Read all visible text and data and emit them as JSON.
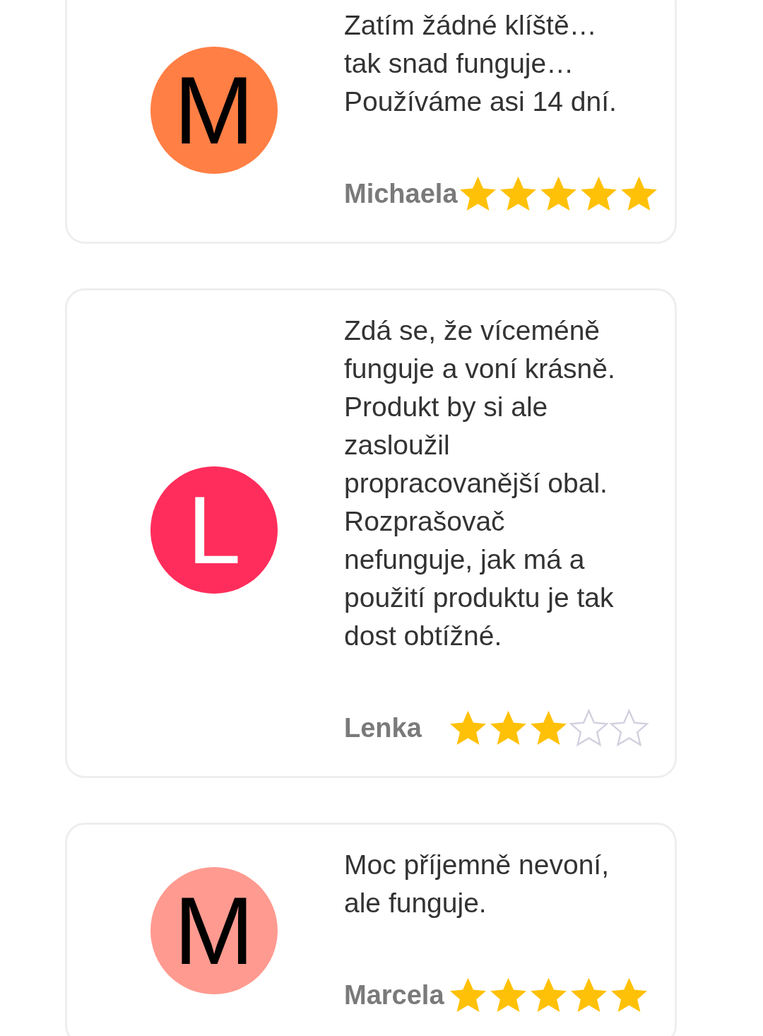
{
  "reviews": [
    {
      "initial": "M",
      "color": "#ff7f45",
      "text": "Zatím žádné klíště… tak snad funguje… Používáme asi 14 dní.",
      "name": "Michaela",
      "stars": 5
    },
    {
      "initial": "L",
      "color": "#ff2d5b",
      "text": "Zdá se, že víceméně funguje a voní krásně. Produkt by si ale zasloužil propracovanější obal. Rozprašovač nefunguje, jak má a použití produktu je tak dost obtížné.",
      "name": "Lenka",
      "stars": 3
    },
    {
      "initial": "M",
      "color": "#ff9a90",
      "text": "Moc příjemně nevoní, ale funguje.",
      "name": "Marcela",
      "stars": 5
    }
  ]
}
